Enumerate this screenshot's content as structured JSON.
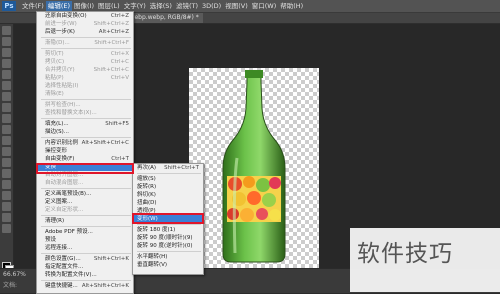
{
  "app": {
    "logo": "Ps"
  },
  "menubar": {
    "items": [
      "文件(F)",
      "编辑(E)",
      "图像(I)",
      "图层(L)",
      "文字(Y)",
      "选择(S)",
      "滤镜(T)",
      "3D(D)",
      "视图(V)",
      "窗口(W)",
      "帮助(H)"
    ],
    "active_index": 1
  },
  "document": {
    "tab_title": "67% (webp.webp, RGB/8#) *"
  },
  "status": {
    "zoom": "66.67%",
    "doc_info": "文档:"
  },
  "edit_menu": {
    "items": [
      {
        "label": "还原自由变换(O)",
        "shortcut": "Ctrl+Z",
        "disabled": false
      },
      {
        "label": "前进一步(W)",
        "shortcut": "Shift+Ctrl+Z",
        "disabled": true
      },
      {
        "label": "后退一步(K)",
        "shortcut": "Alt+Ctrl+Z",
        "disabled": false
      },
      {
        "sep": true
      },
      {
        "label": "渐隐(D)...",
        "shortcut": "Shift+Ctrl+F",
        "disabled": true
      },
      {
        "sep": true
      },
      {
        "label": "剪切(T)",
        "shortcut": "Ctrl+X",
        "disabled": true
      },
      {
        "label": "拷贝(C)",
        "shortcut": "Ctrl+C",
        "disabled": true
      },
      {
        "label": "合并拷贝(Y)",
        "shortcut": "Shift+Ctrl+C",
        "disabled": true
      },
      {
        "label": "粘贴(P)",
        "shortcut": "Ctrl+V",
        "disabled": true
      },
      {
        "label": "选择性粘贴(I)",
        "shortcut": "",
        "disabled": true
      },
      {
        "label": "清除(E)",
        "shortcut": "",
        "disabled": true
      },
      {
        "sep": true
      },
      {
        "label": "拼写检查(H)...",
        "shortcut": "",
        "disabled": true
      },
      {
        "label": "查找和替换文本(X)...",
        "shortcut": "",
        "disabled": true
      },
      {
        "sep": true
      },
      {
        "label": "填充(L)...",
        "shortcut": "Shift+F5",
        "disabled": false
      },
      {
        "label": "描边(S)...",
        "shortcut": "",
        "disabled": false
      },
      {
        "sep": true
      },
      {
        "label": "内容识别比例",
        "shortcut": "Alt+Shift+Ctrl+C",
        "disabled": false
      },
      {
        "label": "操控变形",
        "shortcut": "",
        "disabled": false
      },
      {
        "label": "自由变换(F)",
        "shortcut": "Ctrl+T",
        "disabled": false
      },
      {
        "label": "变换",
        "shortcut": "",
        "disabled": false,
        "highlight": true
      },
      {
        "label": "自动对齐图层...",
        "shortcut": "",
        "disabled": true
      },
      {
        "label": "自动混合图层...",
        "shortcut": "",
        "disabled": true
      },
      {
        "sep": true
      },
      {
        "label": "定义画笔预设(B)...",
        "shortcut": "",
        "disabled": false
      },
      {
        "label": "定义图案...",
        "shortcut": "",
        "disabled": false
      },
      {
        "label": "定义自定形状...",
        "shortcut": "",
        "disabled": true
      },
      {
        "sep": true
      },
      {
        "label": "清理(R)",
        "shortcut": "",
        "disabled": false
      },
      {
        "sep": true
      },
      {
        "label": "Adobe PDF 预设...",
        "shortcut": "",
        "disabled": false
      },
      {
        "label": "预设",
        "shortcut": "",
        "disabled": false
      },
      {
        "label": "远程连接...",
        "shortcut": "",
        "disabled": false
      },
      {
        "sep": true
      },
      {
        "label": "颜色设置(G)...",
        "shortcut": "Shift+Ctrl+K",
        "disabled": false
      },
      {
        "label": "指定配置文件...",
        "shortcut": "",
        "disabled": false
      },
      {
        "label": "转换为配置文件(V)...",
        "shortcut": "",
        "disabled": false
      },
      {
        "sep": true
      },
      {
        "label": "键盘快捷键...",
        "shortcut": "Alt+Shift+Ctrl+K",
        "disabled": false
      }
    ]
  },
  "transform_menu": {
    "items": [
      {
        "label": "再次(A)",
        "shortcut": "Shift+Ctrl+T"
      },
      {
        "sep": true
      },
      {
        "label": "缩放(S)",
        "shortcut": ""
      },
      {
        "label": "旋转(R)",
        "shortcut": ""
      },
      {
        "label": "斜切(K)",
        "shortcut": ""
      },
      {
        "label": "扭曲(D)",
        "shortcut": ""
      },
      {
        "label": "透视(P)",
        "shortcut": ""
      },
      {
        "label": "变形(W)",
        "shortcut": "",
        "highlight": true
      },
      {
        "sep": true
      },
      {
        "label": "旋转 180 度(1)",
        "shortcut": ""
      },
      {
        "label": "旋转 90 度(顺时针)(9)",
        "shortcut": ""
      },
      {
        "label": "旋转 90 度(逆时针)(0)",
        "shortcut": ""
      },
      {
        "sep": true
      },
      {
        "label": "水平翻转(H)",
        "shortcut": ""
      },
      {
        "label": "垂直翻转(V)",
        "shortcut": ""
      }
    ]
  },
  "watermark": {
    "text": "软件技巧"
  }
}
